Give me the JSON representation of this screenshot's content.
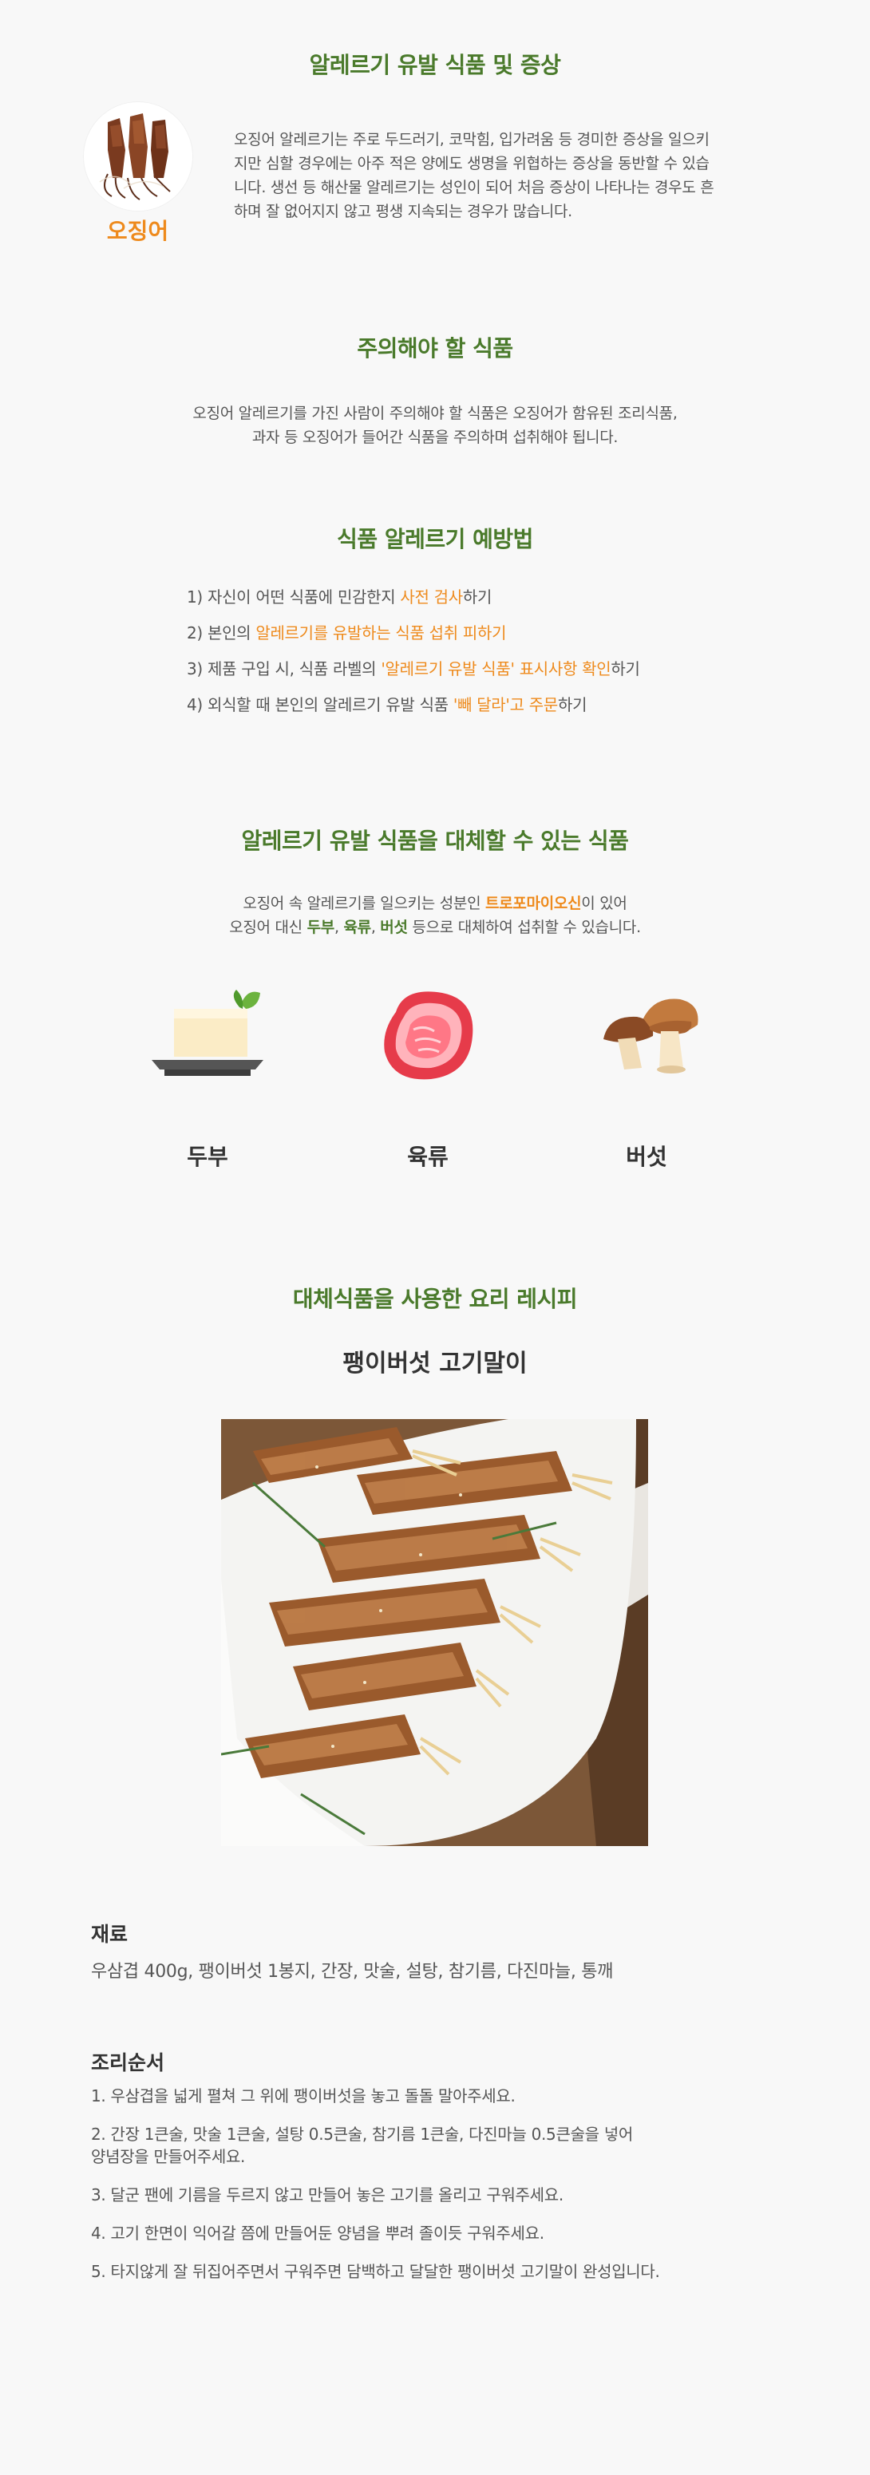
{
  "section1": {
    "title": "알레르기 유발 식품 및 증상",
    "allergen_label": "오징어",
    "lines": [
      "오징어 알레르기는 주로 두드러기, 코막힘, 입가려움 등 경미한 증상을 일으키",
      "지만 심할 경우에는 아주 적은 양에도 생명을 위협하는 증상을 동반할 수 있습",
      "니다. 생선 등 해산물 알레르기는 성인이 되어 처음 증상이 나타나는 경우도 흔",
      "하며 잘 없어지지 않고 평생 지속되는 경우가 많습니다."
    ]
  },
  "section2": {
    "title": "주의해야 할 식품",
    "lines": [
      "오징어 알레르기를 가진 사람이 주의해야 할 식품은 오징어가 함유된 조리식품,",
      "과자 등 오징어가 들어간 식품을 주의하며 섭취해야 됩니다."
    ]
  },
  "section3": {
    "title": "식품 알레르기 예방법",
    "items": [
      {
        "pre": "1) 자신이 어떤 식품에 민감한지 ",
        "hl": "사전 검사",
        "post": "하기"
      },
      {
        "pre": "2) 본인의 ",
        "hl": "알레르기를 유발하는 식품 섭취 피하기",
        "post": ""
      },
      {
        "pre": "3) 제품 구입 시, 식품 라벨의 ",
        "hl": "'알레르기 유발 식품' 표시사항 확인",
        "post": "하기"
      },
      {
        "pre": "4) 외식할 때 본인의 알레르기 유발 식품 ",
        "hl": "'빼 달라'고 주문",
        "post": "하기"
      }
    ]
  },
  "section4": {
    "title": "알레르기 유발 식품을 대체할 수 있는 식품",
    "line1_pre": "오징어 속 알레르기를 일으키는 성분인 ",
    "line1_hl": "트로포마이오신",
    "line1_post": "이 있어",
    "line2_pre": "오징어 대신 ",
    "line2_hl1": "두부",
    "line2_sep1": ", ",
    "line2_hl2": "육류",
    "line2_sep2": ", ",
    "line2_hl3": "버섯",
    "line2_post": " 등으로 대체하여 섭취할 수 있습니다.",
    "foods": [
      "두부",
      "육류",
      "버섯"
    ]
  },
  "section5": {
    "title": "대체식품을 사용한 요리 레시피",
    "recipe_name": "팽이버섯 고기말이",
    "ingredients_heading": "재료",
    "ingredients": "우삼겹 400g, 팽이버섯 1봉지, 간장, 맛술, 설탕, 참기름, 다진마늘, 통깨",
    "steps_heading": "조리순서",
    "steps": [
      "1. 우삼겹을 넓게 펼쳐 그 위에 팽이버섯을 놓고 돌돌 말아주세요.",
      "2. 간장 1큰술, 맛술 1큰술, 설탕 0.5큰술, 참기름 1큰술, 다진마늘 0.5큰술을 넣어",
      "양념장을 만들어주세요.",
      "3. 달군 팬에 기름을 두르지 않고 만들어 놓은 고기를 올리고 구워주세요.",
      "4. 고기 한면이 익어갈 쯤에 만들어둔 양념을 뿌려 졸이듯 구워주세요.",
      "5. 타지않게 잘 뒤집어주면서 구워주면 담백하고 달달한 팽이버섯 고기말이 완성입니다."
    ]
  },
  "colors": {
    "heading_green": "#4a7a2b",
    "highlight_orange": "#ee8a1c",
    "background": "#f8f8f8"
  }
}
